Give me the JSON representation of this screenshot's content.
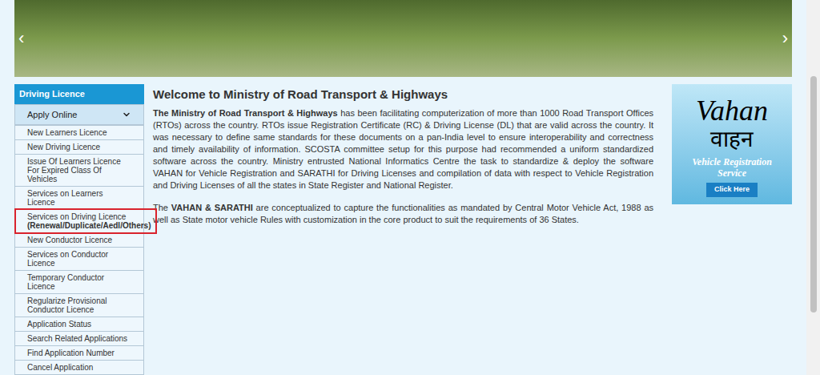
{
  "banner": {
    "prev": "‹",
    "next": "›"
  },
  "sidebar": {
    "title": "Driving Licence",
    "section": {
      "label": "Apply Online",
      "expanded": true
    },
    "items": [
      {
        "label": "New Learners Licence",
        "sublabel": "",
        "highlighted": false
      },
      {
        "label": "New Driving Licence",
        "sublabel": "",
        "highlighted": false
      },
      {
        "label": "Issue Of Learners Licence For Expired Class Of Vehicles",
        "sublabel": "",
        "highlighted": false
      },
      {
        "label": "Services on Learners Licence",
        "sublabel": "",
        "highlighted": false
      },
      {
        "label": "Services on Driving Licence",
        "sublabel": "(Renewal/Duplicate/Aedl/Others)",
        "highlighted": true
      },
      {
        "label": "New Conductor Licence",
        "sublabel": "",
        "highlighted": false
      },
      {
        "label": "Services on Conductor Licence",
        "sublabel": "",
        "highlighted": false
      },
      {
        "label": "Temporary Conductor Licence",
        "sublabel": "",
        "highlighted": false
      },
      {
        "label": "Regularize Provisional Conductor Licence",
        "sublabel": "",
        "highlighted": false
      },
      {
        "label": "Application Status",
        "sublabel": "",
        "highlighted": false
      },
      {
        "label": "Search Related Applications",
        "sublabel": "",
        "highlighted": false
      },
      {
        "label": "Find Application Number",
        "sublabel": "",
        "highlighted": false
      },
      {
        "label": "Cancel Application",
        "sublabel": "",
        "highlighted": false
      }
    ]
  },
  "main": {
    "heading": "Welcome to Ministry of Road Transport & Highways",
    "paragraphs": [
      [
        {
          "text": "The Ministry of Road Transport & Highways",
          "bold": true
        },
        {
          "text": " has been facilitating computerization of more than 1000 Road Transport Offices (RTOs) across the country. RTOs issue Registration Certificate (RC) & Driving License (DL) that are valid across the country. It was necessary to define same standards for these documents on a pan-India level to ensure interoperability and correctness and timely availability of information. SCOSTA committee setup for this purpose had recommended a uniform standardized software across the country. Ministry entrusted National Informatics Centre the task to standardize & deploy the software VAHAN for Vehicle Registration and SARATHI for Driving Licenses and compilation of data with respect to Vehicle Registration and Driving Licenses of all the states in State Register and National Register.",
          "bold": false
        }
      ],
      [
        {
          "text": "The ",
          "bold": false
        },
        {
          "text": "VAHAN & SARATHI",
          "bold": true
        },
        {
          "text": " are conceptualized to capture the functionalities as mandated by Central Motor Vehicle Act, 1988 as well as State motor vehicle Rules with customization in the core product to suit the requirements of 36 States.",
          "bold": false
        }
      ]
    ]
  },
  "ad": {
    "title": "Vahan",
    "script": "वाहन",
    "subtitle": "Vehicle Registration Service",
    "button": "Click Here"
  }
}
